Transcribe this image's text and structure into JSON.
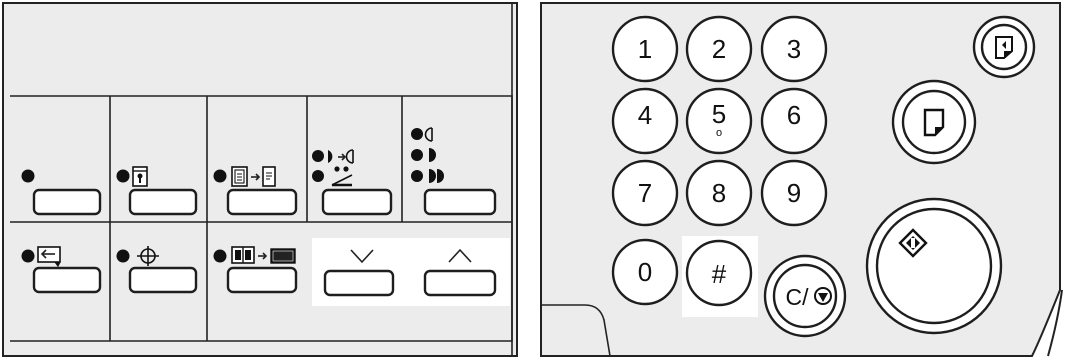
{
  "left_panel": {
    "buttons": [
      {
        "id": "btn-1",
        "icon": "dot-only"
      },
      {
        "id": "btn-2",
        "icon": "key-card-icon"
      },
      {
        "id": "btn-3",
        "icon": "duplex-to-simplex-icon"
      },
      {
        "id": "btn-4",
        "icon": "density-icon"
      },
      {
        "id": "btn-5",
        "icon": "shading-levels-icon"
      },
      {
        "id": "btn-6",
        "icon": "return-arrow-icon"
      },
      {
        "id": "btn-7",
        "icon": "crosshair-icon"
      },
      {
        "id": "btn-8",
        "icon": "book-to-sheet-icon"
      },
      {
        "id": "btn-9",
        "icon": "chevron-down-icon"
      },
      {
        "id": "btn-10",
        "icon": "chevron-up-icon"
      }
    ]
  },
  "keypad": {
    "keys": [
      "1",
      "2",
      "3",
      "4",
      "5",
      "6",
      "7",
      "8",
      "9",
      "0",
      "#"
    ],
    "key5_subscript": "o",
    "clear_stop_label": "C/",
    "clear_stop_icon": "stop-icon"
  },
  "right_controls": {
    "print_button_icon": "page-icon",
    "proof_button_icon": "proof-page-icon",
    "start_button_icon": "diamond-start-icon"
  },
  "colors": {
    "panel": "#ececec",
    "key_fill": "#ffffff",
    "stroke": "#1e1e1e",
    "dot": "#111111"
  }
}
